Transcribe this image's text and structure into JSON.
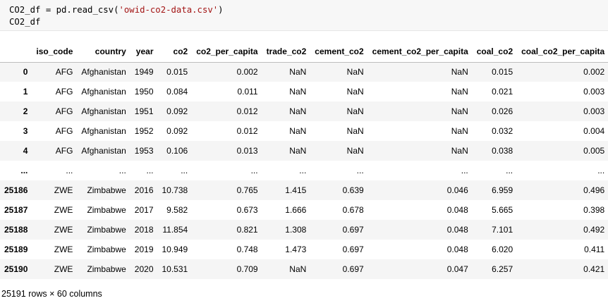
{
  "code": {
    "line1_var": "CO2_df = pd.read_csv(",
    "line1_str": "'owid-co2-data.csv'",
    "line1_end": ")",
    "line2": "CO2_df"
  },
  "table": {
    "columns": [
      "",
      "iso_code",
      "country",
      "year",
      "co2",
      "co2_per_capita",
      "trade_co2",
      "cement_co2",
      "cement_co2_per_capita",
      "coal_co2",
      "coal_co2_per_capita",
      "...",
      "("
    ],
    "rows": [
      [
        "0",
        "AFG",
        "Afghanistan",
        "1949",
        "0.015",
        "0.002",
        "NaN",
        "NaN",
        "NaN",
        "0.015",
        "0.002",
        "...",
        ""
      ],
      [
        "1",
        "AFG",
        "Afghanistan",
        "1950",
        "0.084",
        "0.011",
        "NaN",
        "NaN",
        "NaN",
        "0.021",
        "0.003",
        "...",
        ""
      ],
      [
        "2",
        "AFG",
        "Afghanistan",
        "1951",
        "0.092",
        "0.012",
        "NaN",
        "NaN",
        "NaN",
        "0.026",
        "0.003",
        "...",
        ""
      ],
      [
        "3",
        "AFG",
        "Afghanistan",
        "1952",
        "0.092",
        "0.012",
        "NaN",
        "NaN",
        "NaN",
        "0.032",
        "0.004",
        "...",
        ""
      ],
      [
        "4",
        "AFG",
        "Afghanistan",
        "1953",
        "0.106",
        "0.013",
        "NaN",
        "NaN",
        "NaN",
        "0.038",
        "0.005",
        "...",
        ""
      ],
      [
        "...",
        "...",
        "...",
        "...",
        "...",
        "...",
        "...",
        "...",
        "...",
        "...",
        "...",
        "...",
        ""
      ],
      [
        "25186",
        "ZWE",
        "Zimbabwe",
        "2016",
        "10.738",
        "0.765",
        "1.415",
        "0.639",
        "0.046",
        "6.959",
        "0.496",
        "...",
        ""
      ],
      [
        "25187",
        "ZWE",
        "Zimbabwe",
        "2017",
        "9.582",
        "0.673",
        "1.666",
        "0.678",
        "0.048",
        "5.665",
        "0.398",
        "...",
        ""
      ],
      [
        "25188",
        "ZWE",
        "Zimbabwe",
        "2018",
        "11.854",
        "0.821",
        "1.308",
        "0.697",
        "0.048",
        "7.101",
        "0.492",
        "...",
        ""
      ],
      [
        "25189",
        "ZWE",
        "Zimbabwe",
        "2019",
        "10.949",
        "0.748",
        "1.473",
        "0.697",
        "0.048",
        "6.020",
        "0.411",
        "...",
        ""
      ],
      [
        "25190",
        "ZWE",
        "Zimbabwe",
        "2020",
        "10.531",
        "0.709",
        "NaN",
        "0.697",
        "0.047",
        "6.257",
        "0.421",
        "...",
        ""
      ]
    ]
  },
  "footer": "25191 rows × 60 columns"
}
